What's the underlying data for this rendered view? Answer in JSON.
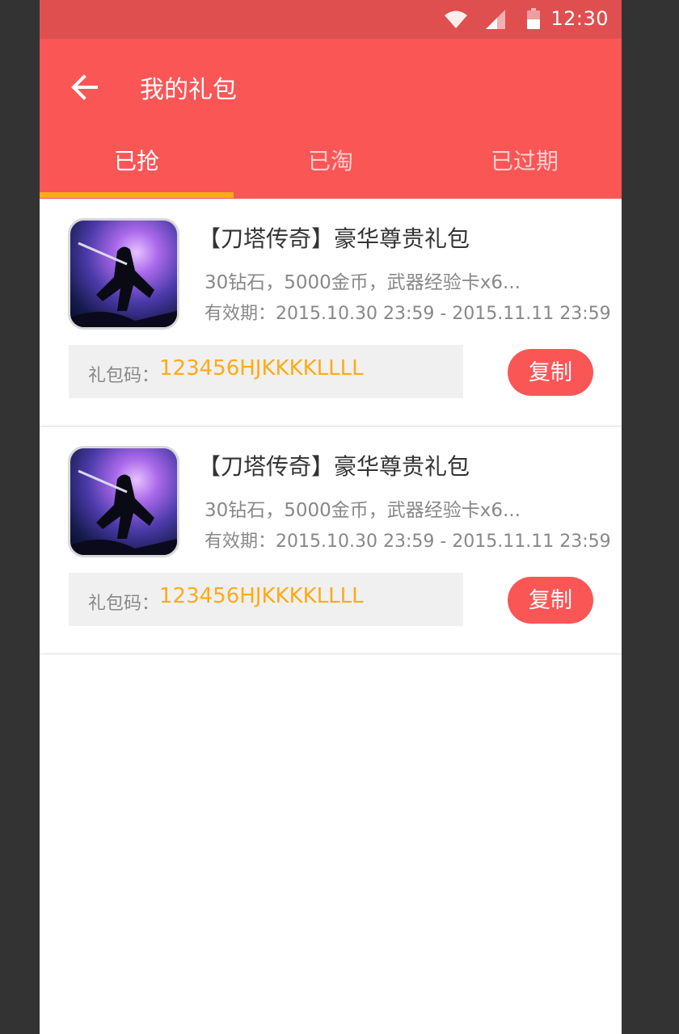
{
  "status_bar": {
    "time": "12:30",
    "icons": [
      "wifi-icon",
      "signal-icon",
      "battery-icon"
    ]
  },
  "header": {
    "title": "我的礼包",
    "back_icon": "arrow-left-icon"
  },
  "tabs": [
    {
      "label": "已抢",
      "active": true
    },
    {
      "label": "已淘",
      "active": false
    },
    {
      "label": "已过期",
      "active": false
    }
  ],
  "gifts": [
    {
      "title": "【刀塔传奇】豪华尊贵礼包",
      "desc": "30钻石，5000金币，武器经验卡x6...",
      "validity": "有效期：2015.10.30  23:59 - 2015.11.11  23:59",
      "code_label": "礼包码：",
      "code": "123456HJKKKKLLLL",
      "copy_label": "复制"
    },
    {
      "title": "【刀塔传奇】豪华尊贵礼包",
      "desc": "30钻石，5000金币，武器经验卡x6...",
      "validity": "有效期：2015.10.30  23:59 - 2015.11.11  23:59",
      "code_label": "礼包码：",
      "code": "123456HJKKKKLLLL",
      "copy_label": "复制"
    }
  ],
  "colors": {
    "primary": "#fa5656",
    "status_bar": "#e04f4f",
    "accent": "#ffaa17",
    "secondary_text": "#888888",
    "code_background": "#f0f0f0"
  }
}
